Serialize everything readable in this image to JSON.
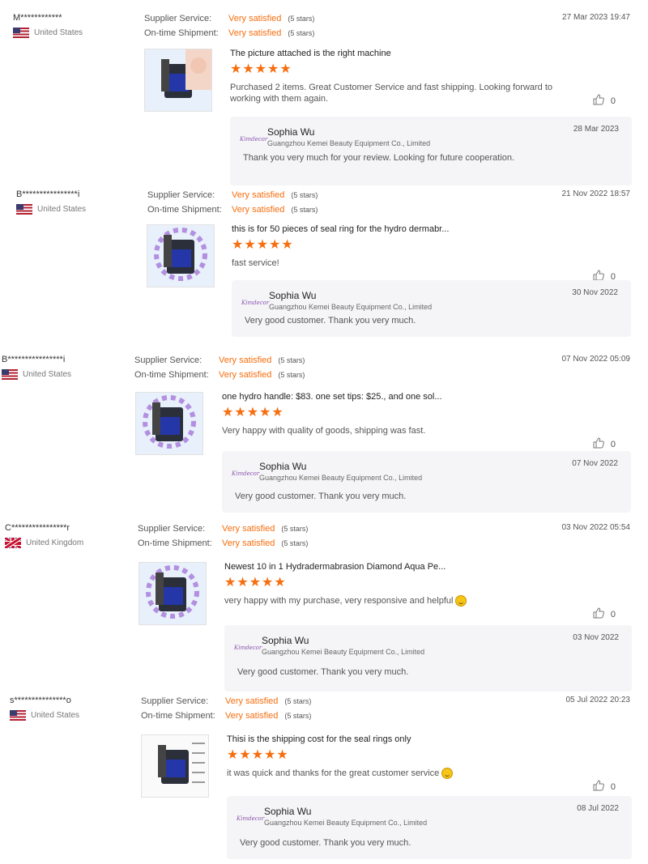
{
  "labels": {
    "supplier_service": "Supplier Service:",
    "on_time_shipment": "On-time Shipment:",
    "very_satisfied": "Very satisfied",
    "five_stars": "(5 stars)"
  },
  "colors": {
    "accent": "#f66e0f",
    "reply_bg": "#f5f5f7"
  },
  "reviews": [
    {
      "buyer": "M************",
      "country": "United States",
      "flag": "us",
      "date": "27 Mar 2023 19:47",
      "title": "The picture attached is the right machine",
      "rating": 5,
      "stars": "★★★★★",
      "comment": "Purchased 2 items.   Great Customer Service and fast shipping.   Looking forward to working with them again.",
      "helpful": "0",
      "reply": {
        "logo_text": "Kimdecor",
        "name": "Sophia Wu",
        "company": "Guangzhou Kemei Beauty Equipment Co., Limited",
        "date": "28 Mar 2023",
        "text": "Thank you very much for your review. Looking for future cooperation."
      }
    },
    {
      "buyer": "B****************i",
      "country": "United States",
      "flag": "us",
      "date": "21 Nov 2022 18:57",
      "title": "this is for 50 pieces of seal ring for the hydro dermabr...",
      "rating": 5,
      "stars": "★★★★★",
      "comment": "fast service!",
      "helpful": "0",
      "reply": {
        "logo_text": "Kimdecor",
        "name": "Sophia Wu",
        "company": "Guangzhou Kemei Beauty Equipment Co., Limited",
        "date": "30 Nov 2022",
        "text": "Very good customer. Thank you very much."
      }
    },
    {
      "buyer": "B****************i",
      "country": "United States",
      "flag": "us",
      "date": "07 Nov 2022 05:09",
      "title": "one hydro handle: $83. one set tips: $25., and one sol...",
      "rating": 5,
      "stars": "★★★★★",
      "comment": "Very happy with quality of goods, shipping was fast.",
      "helpful": "0",
      "reply": {
        "logo_text": "Kimdecor",
        "name": "Sophia Wu",
        "company": "Guangzhou Kemei Beauty Equipment Co., Limited",
        "date": "07 Nov 2022",
        "text": "Very good customer. Thank you very much."
      }
    },
    {
      "buyer": "C****************r",
      "country": "United Kingdom",
      "flag": "uk",
      "date": "03 Nov 2022 05:54",
      "title": "Newest 10 in 1 Hydradermabrasion Diamond Aqua Pe...",
      "rating": 5,
      "stars": "★★★★★",
      "comment": "very happy with my purchase, very responsive and helpful",
      "helpful": "0",
      "reply": {
        "logo_text": "Kimdecor",
        "name": "Sophia Wu",
        "company": "Guangzhou Kemei Beauty Equipment Co., Limited",
        "date": "03 Nov 2022",
        "text": "Very good customer. Thank you very much."
      }
    },
    {
      "buyer": "s***************o",
      "country": "United States",
      "flag": "us",
      "date": "05 Jul 2022 20:23",
      "title": "Thisi is the shipping cost for the seal rings only",
      "rating": 5,
      "stars": "★★★★★",
      "comment": "it was quick and thanks for the great customer service",
      "helpful": "0",
      "reply": {
        "logo_text": "Kimdecor",
        "name": "Sophia Wu",
        "company": "Guangzhou Kemei Beauty Equipment Co., Limited",
        "date": "08 Jul 2022",
        "text": "Very good customer. Thank you very much."
      }
    }
  ]
}
